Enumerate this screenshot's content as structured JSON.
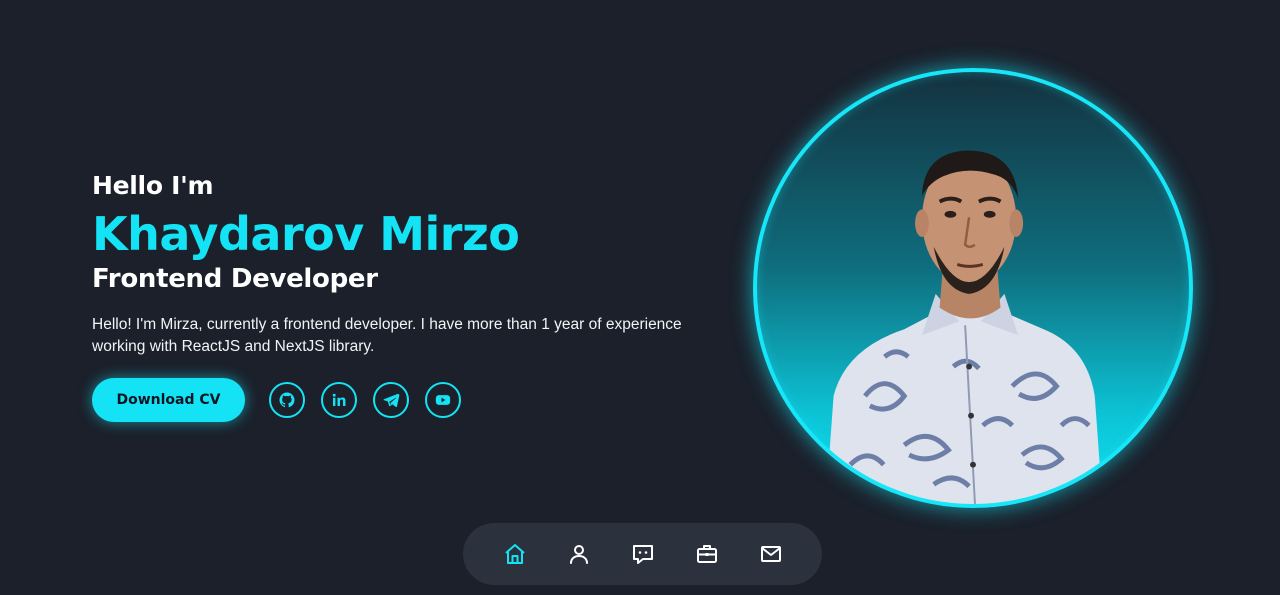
{
  "hero": {
    "greeting": "Hello I'm",
    "name": "Khaydarov Mirzo",
    "role": "Frontend Developer",
    "bio": "Hello! I'm Mirza, currently a frontend developer. I have more than 1 year of experience working with ReactJS and NextJS library.",
    "cv_button": "Download CV"
  },
  "socials": [
    {
      "icon": "github-icon"
    },
    {
      "icon": "linkedin-icon",
      "glyph": "in"
    },
    {
      "icon": "telegram-icon"
    },
    {
      "icon": "youtube-icon"
    }
  ],
  "nav": [
    {
      "icon": "home-icon",
      "active": true
    },
    {
      "icon": "user-icon",
      "active": false
    },
    {
      "icon": "chat-icon",
      "active": false
    },
    {
      "icon": "briefcase-icon",
      "active": false
    },
    {
      "icon": "mail-icon",
      "active": false
    }
  ],
  "colors": {
    "background": "#1b202b",
    "accent": "#14e3f5",
    "nav_background": "#2b313d",
    "text": "#ffffff"
  }
}
